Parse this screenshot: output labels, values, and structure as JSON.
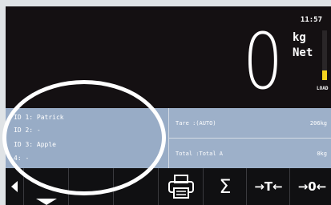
{
  "status": {
    "time": "11:57",
    "weight": "0",
    "unit": "kg",
    "mode": "Net",
    "load_label": "LOAD",
    "load_level": 0.2
  },
  "ids": [
    {
      "label": "ID 1: Patrick"
    },
    {
      "label": "ID 2: -"
    },
    {
      "label": "ID 3: Apple"
    },
    {
      "label": "  4: -"
    }
  ],
  "tare": {
    "label": "Tare  :(AUTO)",
    "value": "206kg"
  },
  "total": {
    "label": "Total :Total A",
    "value": "0kg"
  },
  "toolbar": {
    "icons": [
      "left-arrow-icon",
      "down-arrow-icon",
      "printer-icon",
      "sum-icon",
      "tare-icon",
      "zero-icon"
    ],
    "sum_label": "Σ",
    "tare_label": "→T←",
    "zero_label": "→0←"
  },
  "colors": {
    "display_bg": "#141012",
    "panel_bg": "#98acc6",
    "load_accent": "#f4d21f"
  }
}
